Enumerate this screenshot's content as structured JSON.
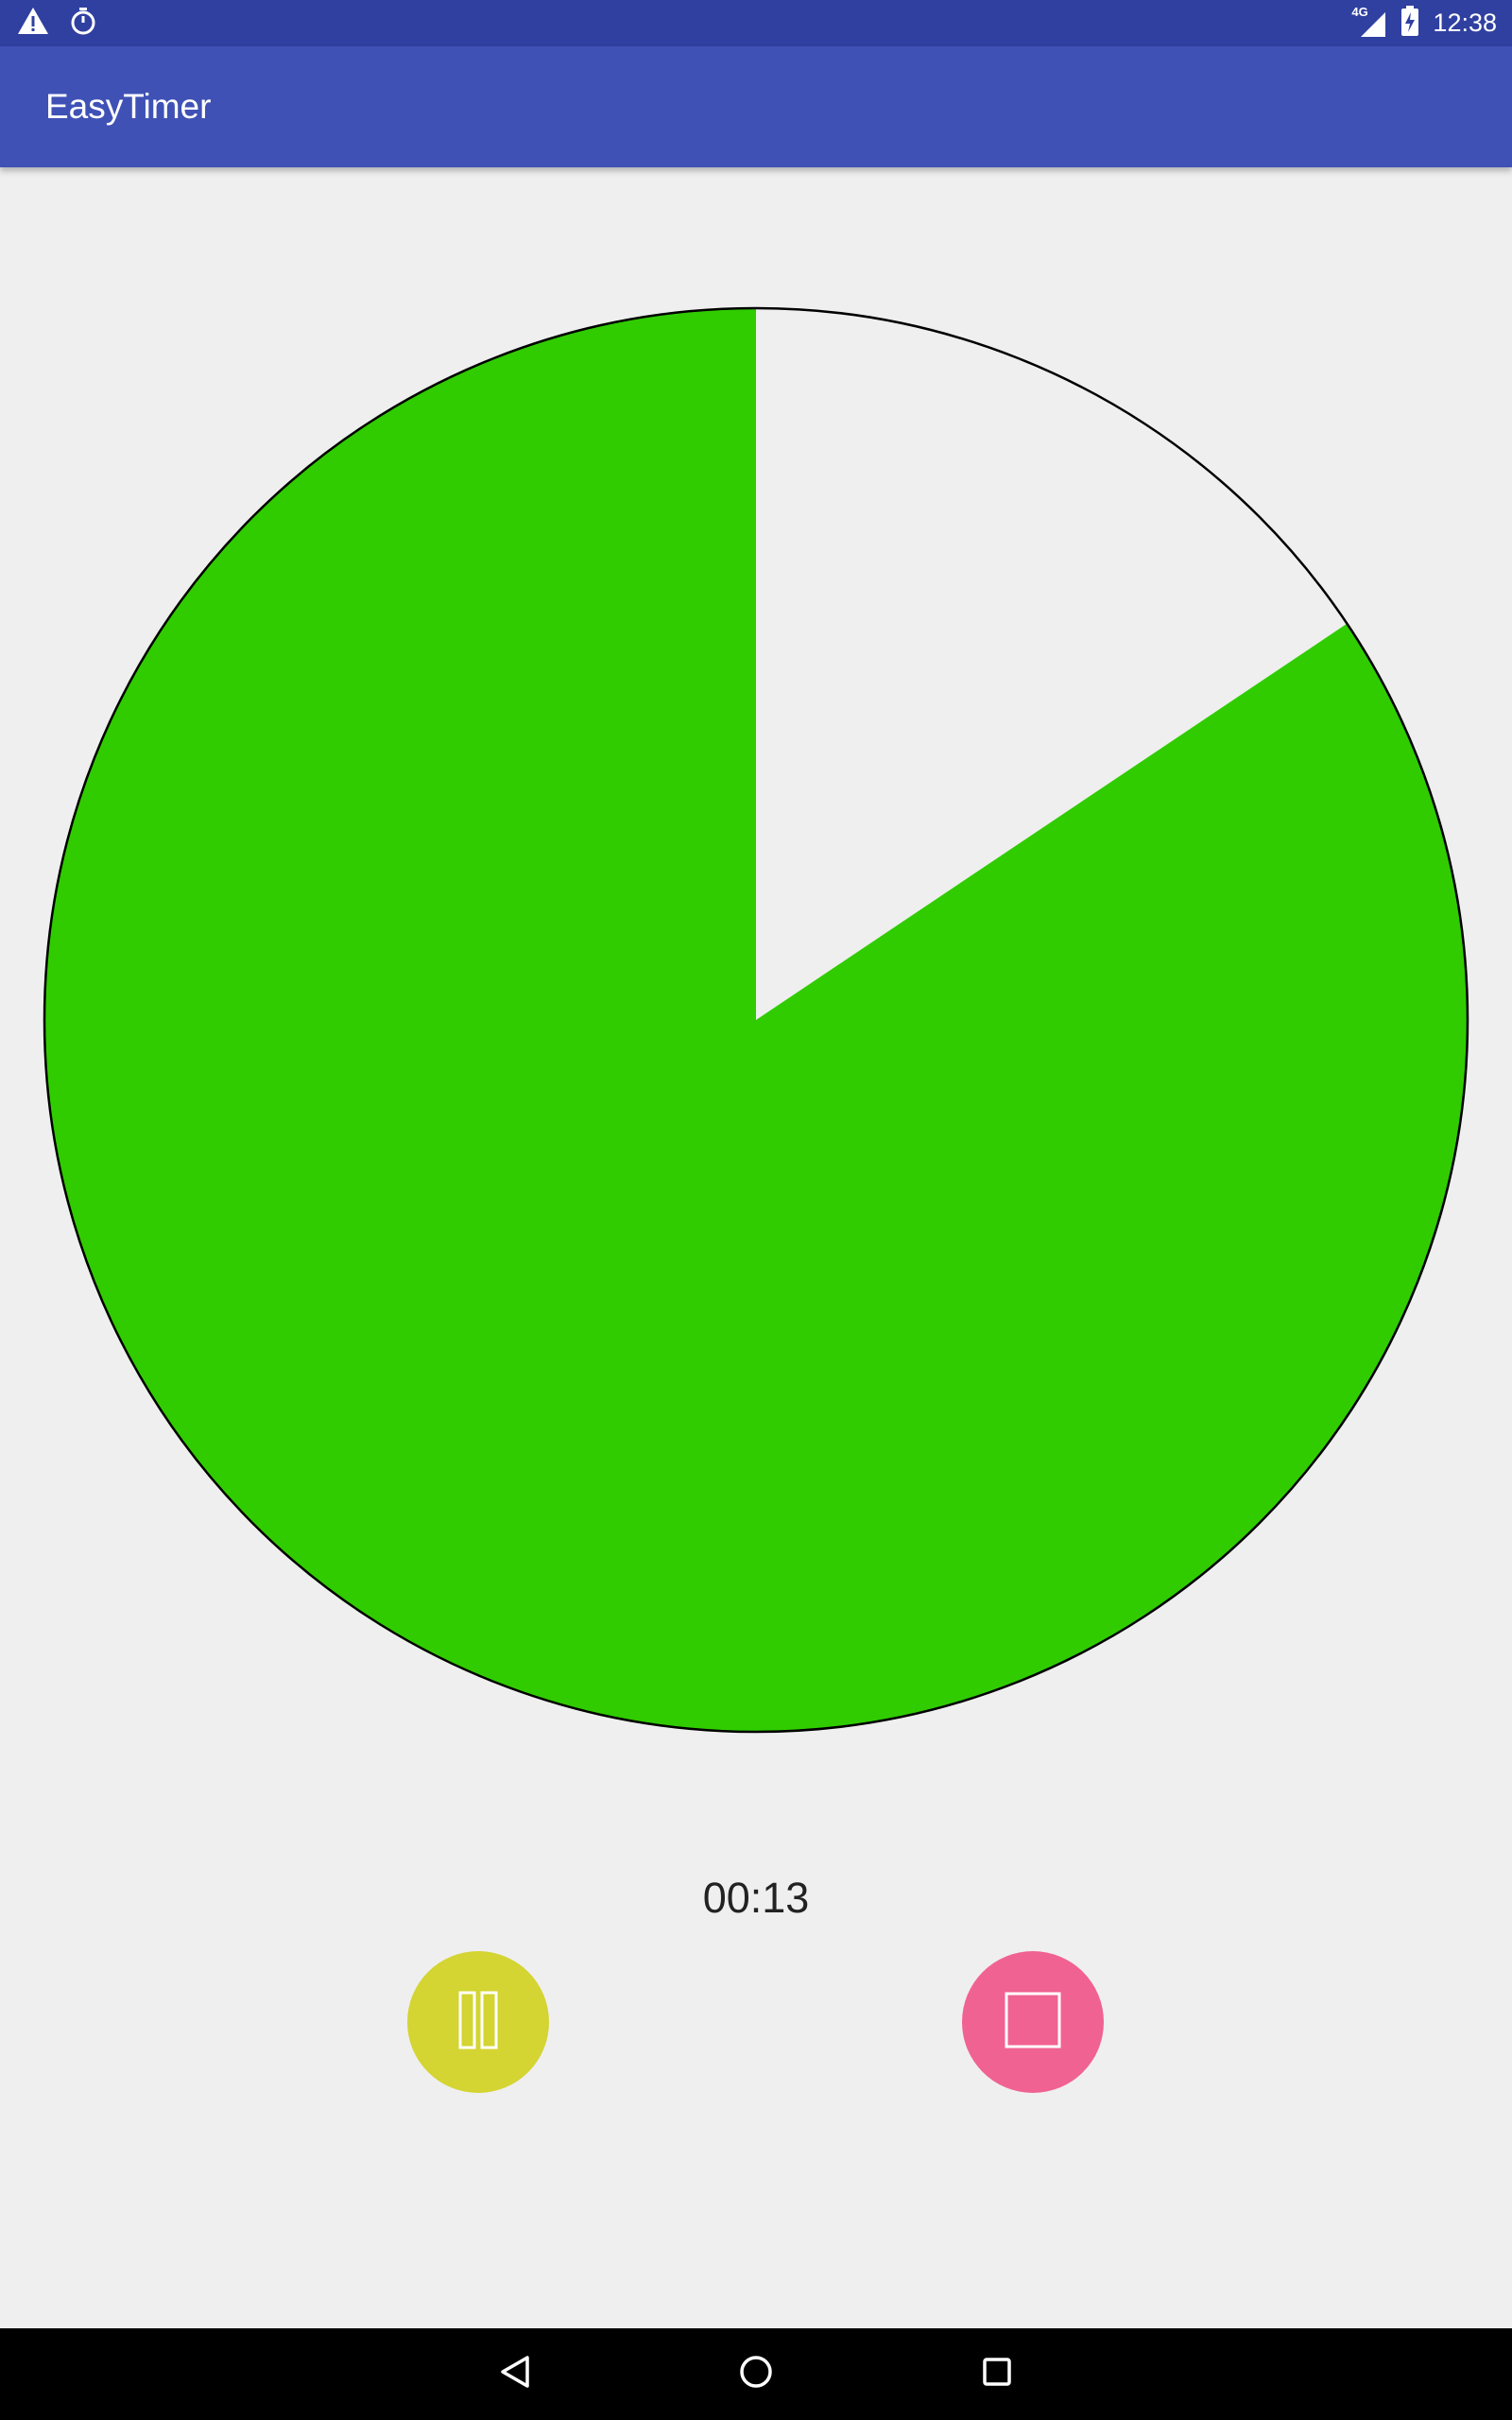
{
  "status_bar": {
    "time": "12:38",
    "network_label": "4G",
    "icons": [
      "warning-icon",
      "stopwatch-icon",
      "signal-icon",
      "battery-charging-icon"
    ]
  },
  "app_bar": {
    "title": "EasyTimer"
  },
  "timer": {
    "readout": "00:13",
    "remaining_fraction": 0.844,
    "remaining_color": "#30cc00",
    "elapsed_color": "#efefef",
    "outline_color": "#000000"
  },
  "controls": {
    "pause_icon": "pause-icon",
    "pause_color": "#d4d432",
    "stop_icon": "stop-icon",
    "stop_color": "#f06292"
  },
  "nav_bar": {
    "icons": [
      "back-icon",
      "home-icon",
      "recents-icon"
    ]
  }
}
